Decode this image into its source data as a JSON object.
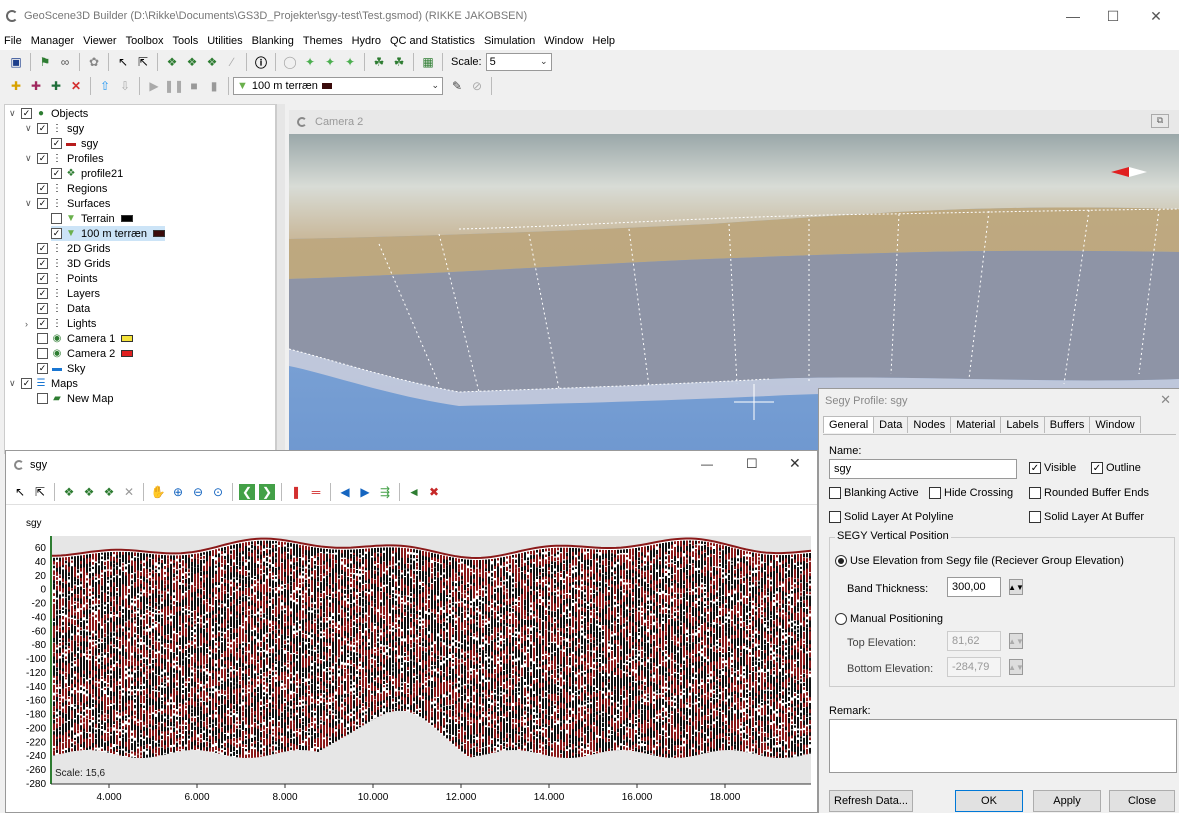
{
  "window": {
    "title": "GeoScene3D Builder (D:\\Rikke\\Documents\\GS3D_Projekter\\sgy-test\\Test.gsmod) (RIKKE JAKOBSEN)"
  },
  "menu": [
    "File",
    "Manager",
    "Viewer",
    "Toolbox",
    "Tools",
    "Utilities",
    "Blanking",
    "Themes",
    "Hydro",
    "QC and Statistics",
    "Simulation",
    "Window",
    "Help"
  ],
  "toolbar": {
    "scale_label": "Scale:",
    "scale_value": "5",
    "layer_select": "100 m terræn"
  },
  "tree": {
    "items": [
      {
        "label": "Objects"
      },
      {
        "label": "sgy"
      },
      {
        "label": "sgy"
      },
      {
        "label": "Profiles"
      },
      {
        "label": "profile21"
      },
      {
        "label": "Regions"
      },
      {
        "label": "Surfaces"
      },
      {
        "label": "Terrain"
      },
      {
        "label": "100 m terræn"
      },
      {
        "label": "2D Grids"
      },
      {
        "label": "3D Grids"
      },
      {
        "label": "Points"
      },
      {
        "label": "Layers"
      },
      {
        "label": "Data"
      },
      {
        "label": "Lights"
      },
      {
        "label": "Camera 1"
      },
      {
        "label": "Camera 2"
      },
      {
        "label": "Sky"
      },
      {
        "label": "Maps"
      },
      {
        "label": "New Map"
      }
    ]
  },
  "camera": {
    "title": "Camera 2"
  },
  "sgy_window": {
    "title": "sgy",
    "ylabel": "sgy",
    "scale_text": "Scale: 15,6"
  },
  "chart_data": {
    "type": "heatmap",
    "ylabel": "sgy",
    "y_ticks": [
      "60",
      "40",
      "20",
      "0",
      "-20",
      "-40",
      "-60",
      "-80",
      "-100",
      "-120",
      "-140",
      "-160",
      "-180",
      "-200",
      "-220",
      "-240",
      "-260",
      "-280"
    ],
    "x_ticks": [
      "4.000",
      "6.000",
      "8.000",
      "10.000",
      "12.000",
      "14.000",
      "16.000",
      "18.000"
    ],
    "colors": {
      "positive": "#8b1a1a",
      "negative": "#111111",
      "background": "#ffffff"
    }
  },
  "dialog": {
    "title": "Segy Profile: sgy",
    "tabs": [
      "General",
      "Data",
      "Nodes",
      "Material",
      "Labels",
      "Buffers",
      "Window"
    ],
    "name_label": "Name:",
    "name_value": "sgy",
    "visible": "Visible",
    "outline": "Outline",
    "blanking_active": "Blanking Active",
    "hide_crossing": "Hide Crossing",
    "rounded_buffer_ends": "Rounded Buffer Ends",
    "solid_polyline": "Solid Layer At Polyline",
    "solid_buffer": "Solid Layer At Buffer",
    "vertical_group": "SEGY Vertical Position",
    "use_elevation": "Use Elevation from Segy file (Reciever Group Elevation)",
    "band_thickness_label": "Band Thickness:",
    "band_thickness_value": "300,00",
    "manual_positioning": "Manual Positioning",
    "top_elevation_label": "Top Elevation:",
    "top_elevation_value": "81,62",
    "bottom_elevation_label": "Bottom Elevation:",
    "bottom_elevation_value": "-284,79",
    "remark_label": "Remark:",
    "refresh": "Refresh Data...",
    "ok": "OK",
    "apply": "Apply",
    "close": "Close"
  }
}
